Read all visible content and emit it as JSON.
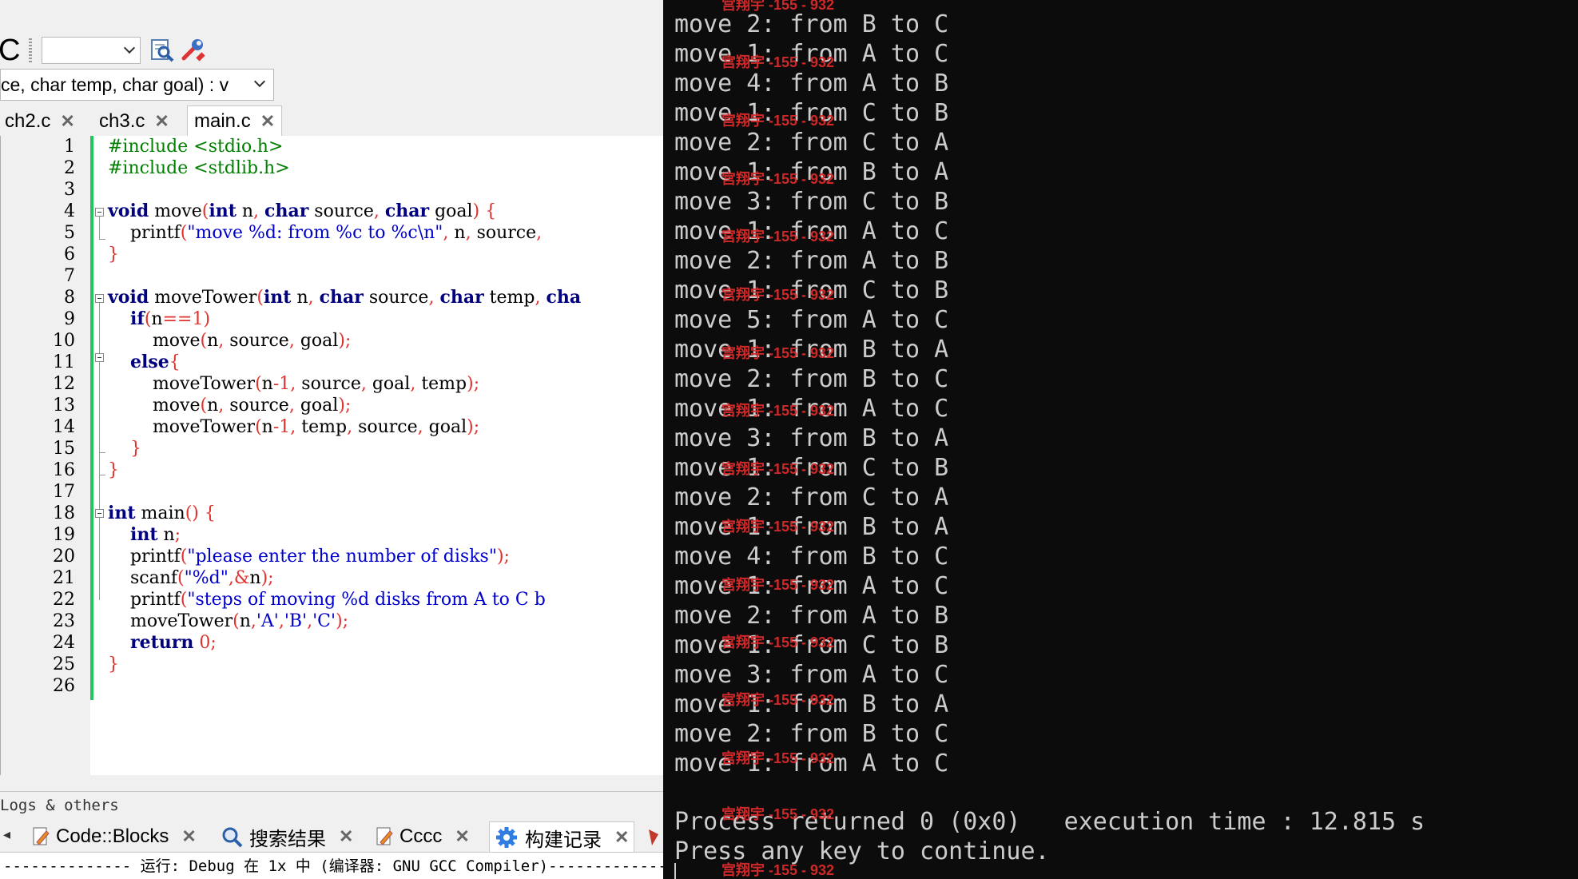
{
  "ide": {
    "toolbar_partial_letter": "C",
    "signature_combo_text": "ce, char temp, char goal) : ᴠ",
    "tabs": [
      {
        "label": "ch2.c"
      },
      {
        "label": "ch3.c"
      },
      {
        "label": "main.c"
      }
    ],
    "close_glyph": "✕",
    "line_numbers": [
      "1",
      "2",
      "3",
      "4",
      "5",
      "6",
      "7",
      "8",
      "9",
      "10",
      "11",
      "12",
      "13",
      "14",
      "15",
      "16",
      "17",
      "18",
      "19",
      "20",
      "21",
      "22",
      "23",
      "24",
      "25",
      "26"
    ],
    "logs_title": "Logs & others",
    "bottom_tabs": [
      {
        "label": "Code::Blocks"
      },
      {
        "label": "搜索结果"
      },
      {
        "label": "Cccc"
      },
      {
        "label": "构建记录"
      }
    ],
    "build_log_line": "-------------- 运行: Debug 在 1x 中 (编译器: GNU GCC Compiler)---------------"
  },
  "console": {
    "moves": [
      "move 2: from B to C",
      "move 1: from A to C",
      "move 4: from A to B",
      "move 1: from C to B",
      "move 2: from C to A",
      "move 1: from B to A",
      "move 3: from C to B",
      "move 1: from A to C",
      "move 2: from A to B",
      "move 1: from C to B",
      "move 5: from A to C",
      "move 1: from B to A",
      "move 2: from B to C",
      "move 1: from A to C",
      "move 3: from B to A",
      "move 1: from C to B",
      "move 2: from C to A",
      "move 1: from B to A",
      "move 4: from B to C",
      "move 1: from A to C",
      "move 2: from A to B",
      "move 1: from C to B",
      "move 3: from A to C",
      "move 1: from B to A",
      "move 2: from B to C",
      "move 1: from A to C"
    ],
    "process_line": "Process returned 0 (0x0)   execution time : 12.815 s",
    "press_line": "Press any key to continue.",
    "watermark": "宫翔宇 -155 - 932"
  },
  "colors": {
    "console_bg": "#0c0c0c",
    "console_text": "#cccccc",
    "keyword": "#00007f",
    "preprocessor": "#007f00",
    "string": "#0000cc",
    "number": "#e0322e",
    "change_bar": "#22c55e",
    "watermark": "#d92a2a"
  }
}
